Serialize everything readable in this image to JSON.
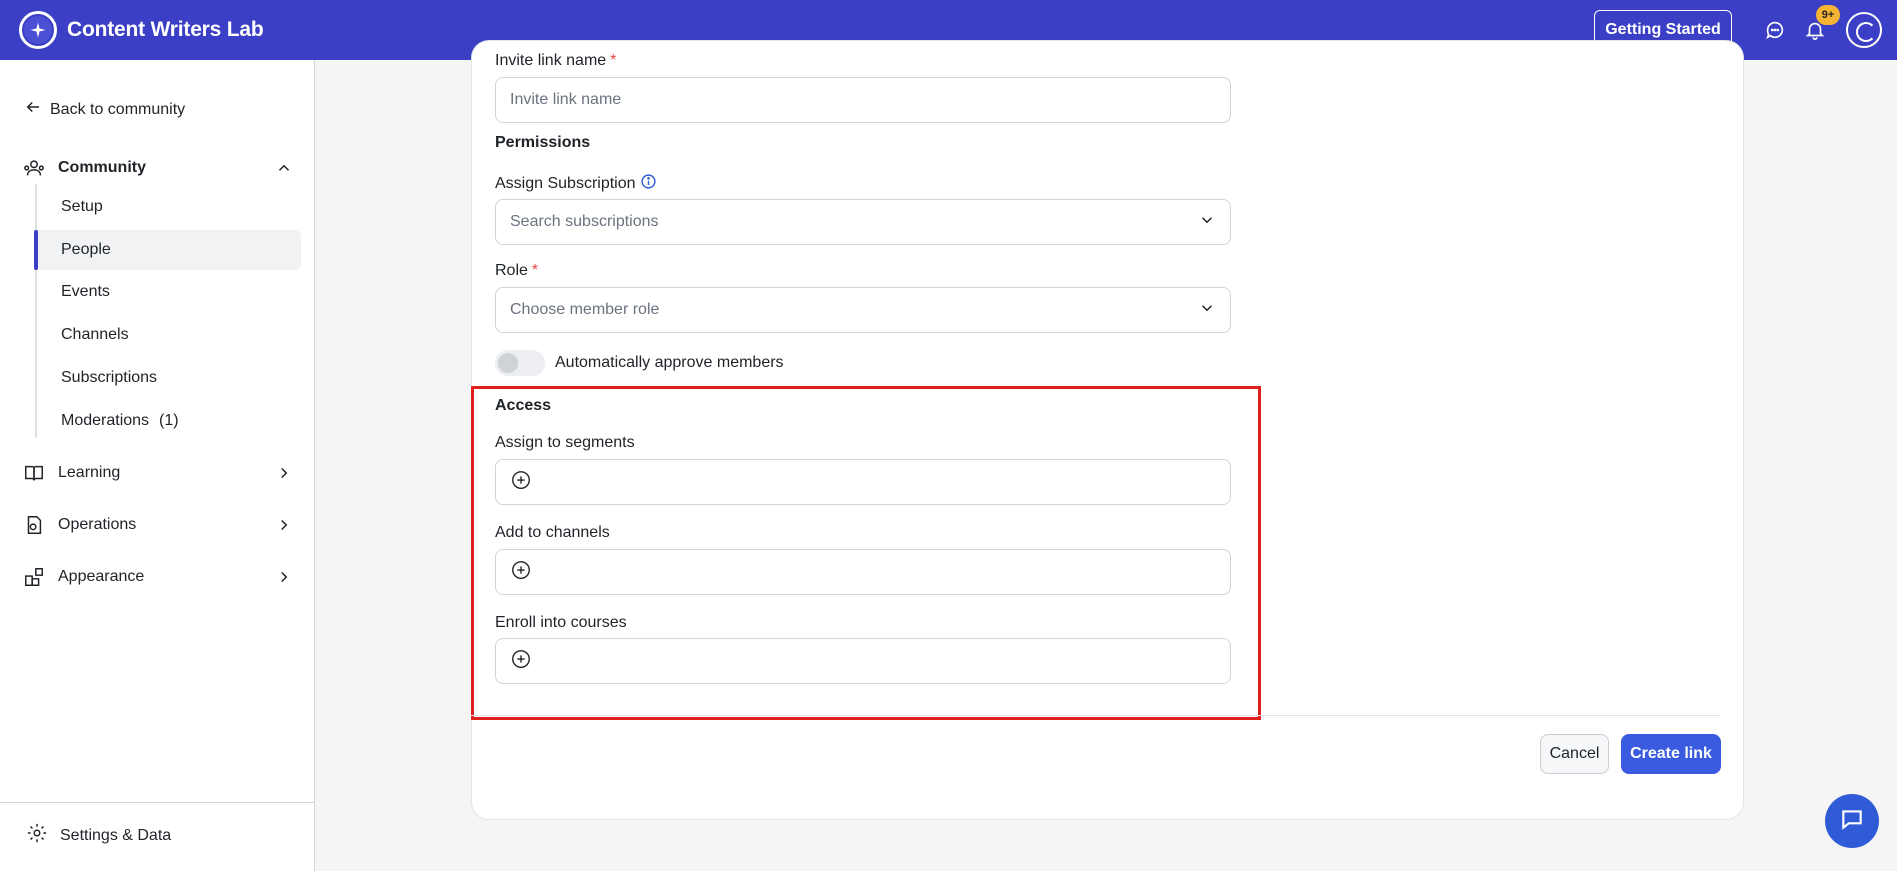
{
  "header": {
    "app_title": "Content Writers Lab",
    "getting_started": "Getting Started",
    "notification_badge": "9+",
    "brand_color": "#3a3fc5"
  },
  "sidebar": {
    "back_link": "Back to community",
    "groups": [
      {
        "label": "Community",
        "icon": "community-icon",
        "expanded": true
      },
      {
        "label": "Learning",
        "icon": "book-icon",
        "expanded": false
      },
      {
        "label": "Operations",
        "icon": "operations-icon",
        "expanded": false
      },
      {
        "label": "Appearance",
        "icon": "appearance-icon",
        "expanded": false
      }
    ],
    "community_items": [
      {
        "label": "Setup",
        "active": false
      },
      {
        "label": "People",
        "active": true
      },
      {
        "label": "Events",
        "active": false
      },
      {
        "label": "Channels",
        "active": false
      },
      {
        "label": "Subscriptions",
        "active": false
      },
      {
        "label": "Moderations",
        "count": "(1)",
        "active": false
      }
    ],
    "settings": "Settings & Data"
  },
  "form": {
    "invite_link_name_label": "Invite link name",
    "invite_link_name_placeholder": "Invite link name",
    "permissions_title": "Permissions",
    "assign_subscription_label": "Assign Subscription",
    "assign_subscription_placeholder": "Search subscriptions",
    "role_label": "Role",
    "role_placeholder": "Choose member role",
    "auto_approve_label": "Automatically approve members",
    "auto_approve_on": false,
    "access_title": "Access",
    "segments_label": "Assign to segments",
    "channels_label": "Add to channels",
    "courses_label": "Enroll into courses",
    "required_mark": "*"
  },
  "actions": {
    "cancel": "Cancel",
    "create": "Create link"
  }
}
